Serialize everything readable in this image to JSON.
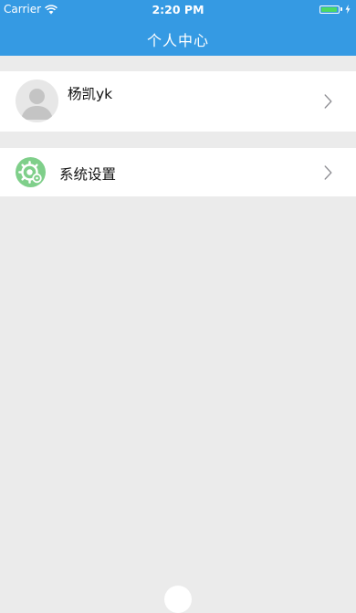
{
  "status_bar": {
    "carrier": "Carrier",
    "time": "2:20 PM",
    "battery_level": 0.95,
    "battery_color": "#4cd964"
  },
  "nav": {
    "title": "个人中心",
    "background": "#359ae3"
  },
  "profile": {
    "name": "杨凯yk",
    "avatar_icon": "default-avatar-icon",
    "chevron_icon": "chevron-right-icon"
  },
  "settings": {
    "label": "系统设置",
    "icon": "gear-icon",
    "icon_color": "#7fcf8a",
    "chevron_icon": "chevron-right-icon"
  }
}
